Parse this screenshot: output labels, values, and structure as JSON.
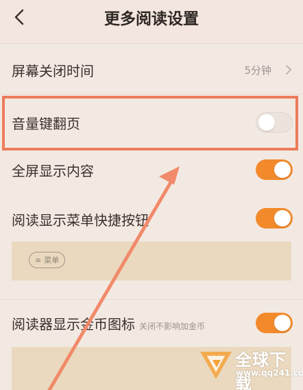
{
  "header": {
    "title": "更多阅读设置"
  },
  "settings": {
    "screen_off": {
      "label": "屏幕关闭时间",
      "value": "5分钟"
    },
    "volume_page": {
      "label": "音量键翻页",
      "enabled": false
    },
    "fullscreen": {
      "label": "全屏显示内容",
      "enabled": true
    },
    "menu_shortcut": {
      "label": "阅读显示菜单快捷按钮",
      "enabled": true,
      "preview_menu_label": "菜单"
    },
    "coin_icon": {
      "label": "阅读器显示金币图标",
      "hint": "关闭不影响加金币",
      "enabled": true
    }
  },
  "watermark": {
    "name": "全球下载",
    "url": "www.qq241.com"
  },
  "colors": {
    "accent": "#f28a2c",
    "annotation": "#ec7c5c",
    "background": "#f3e9e3"
  }
}
